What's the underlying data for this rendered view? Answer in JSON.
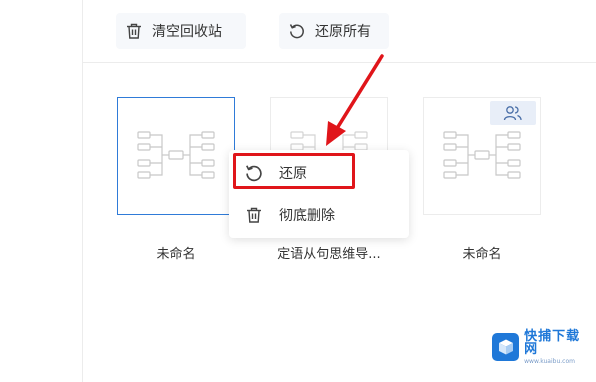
{
  "toolbar": {
    "empty_recycle_label": "清空回收站",
    "restore_all_label": "还原所有"
  },
  "files": [
    {
      "name": "未命名",
      "selected": true,
      "shared": false
    },
    {
      "name": "定语从句思维导...",
      "selected": false,
      "shared": false
    },
    {
      "name": "未命名",
      "selected": false,
      "shared": true
    }
  ],
  "context_menu": {
    "items": [
      {
        "label": "还原",
        "icon": "restore-icon"
      },
      {
        "label": "彻底删除",
        "icon": "trash-icon"
      }
    ]
  },
  "annotation": {
    "color": "#e0151a"
  },
  "watermark": {
    "brand": "快捕下载网",
    "url": "www.kuaibu.com"
  },
  "colors": {
    "accent": "#2f7bd8",
    "highlight": "#e0151a",
    "watermark": "#1f78d8"
  }
}
